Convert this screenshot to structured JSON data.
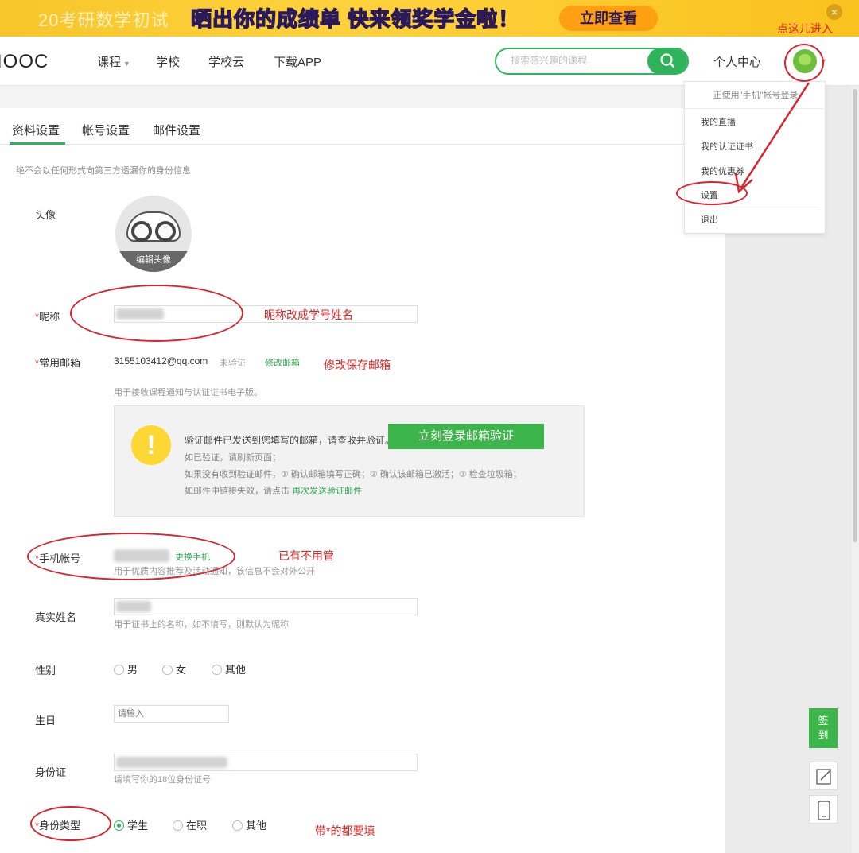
{
  "banner": {
    "left_text": "20考研数学初试",
    "main_text": "晒出你的成绩单 快来领奖学金啦！",
    "button": "立即查看",
    "close": "×"
  },
  "nav": {
    "logo": "IOOC",
    "links": [
      "课程",
      "学校",
      "学校云",
      "下载APP"
    ],
    "search_placeholder": "搜索感兴趣的课程",
    "personal_center": "个人中心"
  },
  "dropdown": {
    "header": "正使用\"手机\"帐号登录",
    "items": [
      "我的直播",
      "我的认证证书",
      "我的优惠券",
      "设置",
      "退出"
    ]
  },
  "tabs": [
    "资料设置",
    "帐号设置",
    "邮件设置"
  ],
  "privacy_note": "绝不会以任何形式向第三方透漏你的身份信息",
  "form": {
    "avatar_label": "头像",
    "edit_avatar": "编辑头像",
    "nickname_label": "昵称",
    "email_label": "常用邮箱",
    "email_value": "3155103412@qq.com",
    "email_status": "未验证",
    "email_modify": "修改邮箱",
    "email_hint": "用于接收课程通知与认证证书电子版。",
    "verify": {
      "icon": "!",
      "line1": "验证邮件已发送到您填写的邮箱，请查收并验证。",
      "button": "立刻登录邮箱验证",
      "line2": "如已验证，请刷新页面；",
      "line3": "如果没有收到验证邮件，① 确认邮箱填写正确；② 确认该邮箱已激活；③ 检查垃圾箱；",
      "line4_prefix": "如邮件中链接失效，请点击",
      "line4_link": "再次发送验证邮件"
    },
    "phone_label": "手机帐号",
    "phone_change": "更换手机",
    "phone_hint": "用于优质内容推荐及活动通知，该信息不会对外公开",
    "realname_label": "真实姓名",
    "realname_hint": "用于证书上的名称，如不填写，则默认为昵称",
    "gender_label": "性别",
    "gender_options": [
      "男",
      "女",
      "其他"
    ],
    "birthday_label": "生日",
    "birthday_placeholder": "请输入",
    "idcard_label": "身份证",
    "idcard_hint": "请填写你的18位身份证号",
    "idtype_label": "身份类型",
    "idtype_options": [
      "学生",
      "在职",
      "其他"
    ],
    "required_mark": "*"
  },
  "annotations": {
    "click_here": "点这儿进入",
    "nickname": "昵称改成学号姓名",
    "email": "修改保存邮箱",
    "phone": "已有不用管",
    "required": "带*的都要填"
  },
  "side": {
    "checkin_1": "签",
    "checkin_2": "到"
  },
  "colors": {
    "brand_green": "#2fb35a",
    "annotation_red": "#d9232e",
    "banner_yellow": "#f9c21e"
  }
}
